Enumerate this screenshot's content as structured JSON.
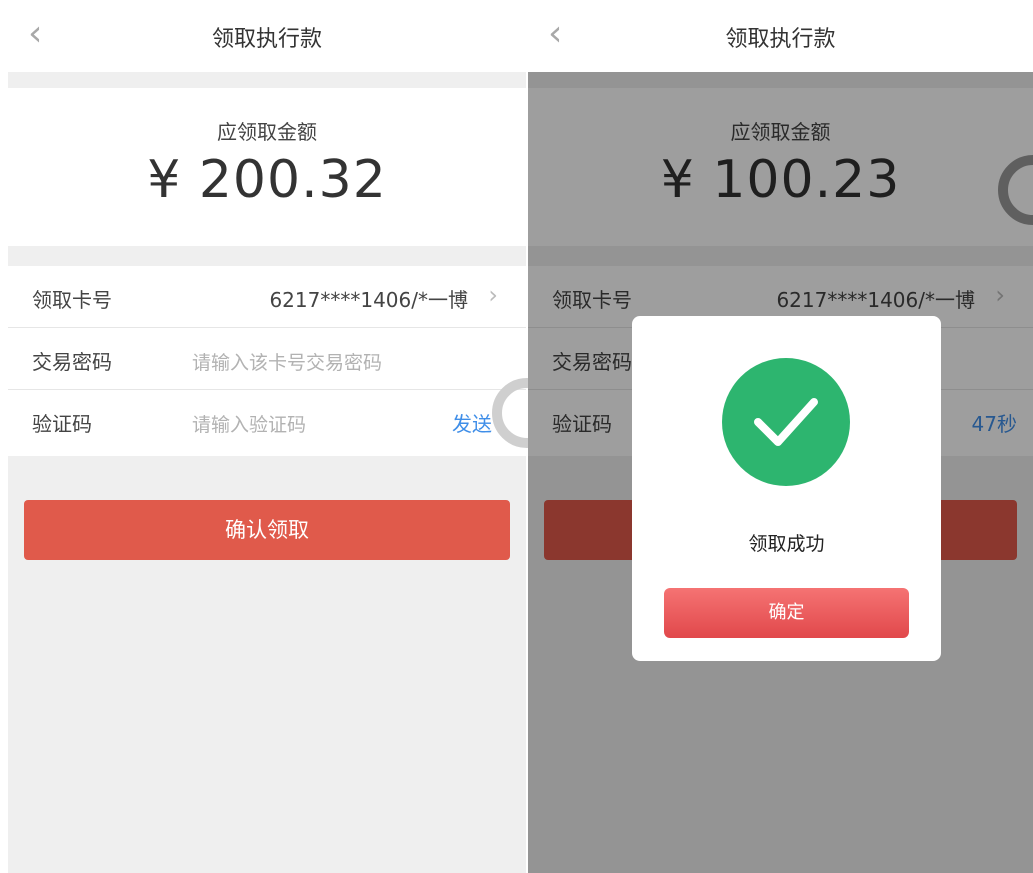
{
  "left": {
    "nav": {
      "back_icon": "‹",
      "title": "领取执行款"
    },
    "amount": {
      "label": "应领取金额",
      "value": "¥ 200.32"
    },
    "form": {
      "card_label": "领取卡号",
      "card_value": "6217****1406/*一博",
      "password_label": "交易密码",
      "password_placeholder": "请输入该卡号交易密码",
      "code_label": "验证码",
      "code_placeholder": "请输入验证码",
      "send_label": "发送"
    },
    "confirm_label": "确认领取"
  },
  "right": {
    "nav": {
      "back_icon": "‹",
      "title": "领取执行款"
    },
    "amount": {
      "label": "应领取金额",
      "value": "¥ 100.23"
    },
    "form": {
      "card_label": "领取卡号",
      "card_value": "6217****1406/*一博",
      "password_label": "交易密码",
      "code_label": "验证码",
      "countdown_label": "47秒"
    },
    "dialog": {
      "icon": "check-circle-icon",
      "message": "领取成功",
      "ok_label": "确定"
    }
  },
  "colors": {
    "primary": "#e05a4b",
    "link": "#3f8ee8",
    "success": "#2db56f",
    "page_bg": "#efefef"
  }
}
